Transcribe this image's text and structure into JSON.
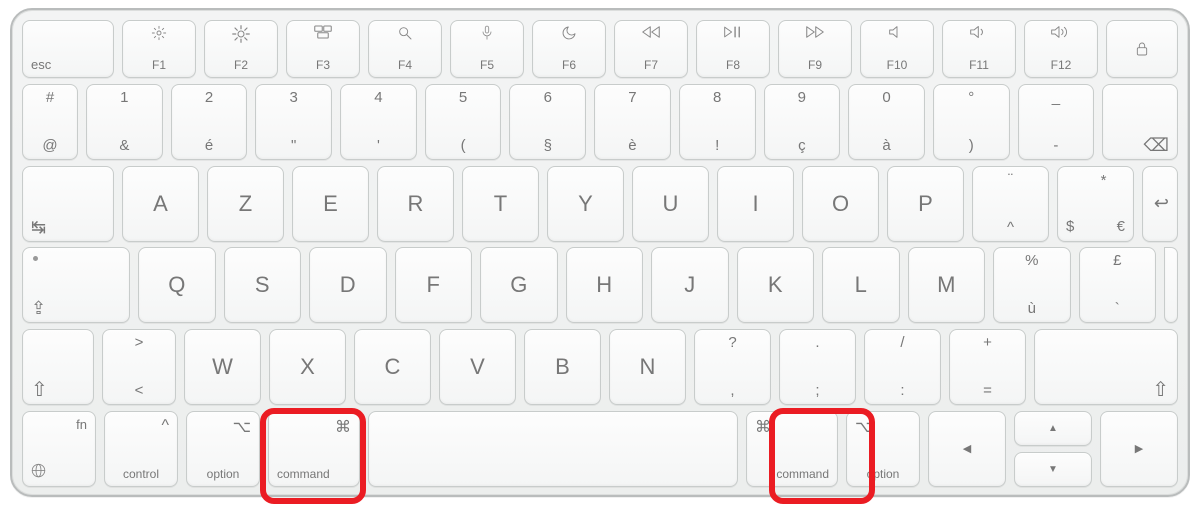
{
  "annotations": {
    "highlighted_keys": [
      "command-left",
      "command-right"
    ],
    "highlight_color": "#EB1C23"
  },
  "layout": "AZERTY-French",
  "fn_row": {
    "esc": "esc",
    "keys": [
      {
        "id": "f1",
        "label": "F1",
        "icon": "brightness-down"
      },
      {
        "id": "f2",
        "label": "F2",
        "icon": "brightness-up"
      },
      {
        "id": "f3",
        "label": "F3",
        "icon": "mission-control"
      },
      {
        "id": "f4",
        "label": "F4",
        "icon": "spotlight"
      },
      {
        "id": "f5",
        "label": "F5",
        "icon": "dictation"
      },
      {
        "id": "f6",
        "label": "F6",
        "icon": "dnd"
      },
      {
        "id": "f7",
        "label": "F7",
        "icon": "rewind"
      },
      {
        "id": "f8",
        "label": "F8",
        "icon": "play-pause"
      },
      {
        "id": "f9",
        "label": "F9",
        "icon": "forward"
      },
      {
        "id": "f10",
        "label": "F10",
        "icon": "mute"
      },
      {
        "id": "f11",
        "label": "F11",
        "icon": "vol-down"
      },
      {
        "id": "f12",
        "label": "F12",
        "icon": "vol-up"
      }
    ],
    "lock": "lock"
  },
  "row1": {
    "lead": {
      "id": "at-hash",
      "top": "#",
      "bottom": "@"
    },
    "keys": [
      {
        "id": "k1",
        "top": "1",
        "bottom": "&"
      },
      {
        "id": "k2",
        "top": "2",
        "bottom": "é"
      },
      {
        "id": "k3",
        "top": "3",
        "bottom": "\""
      },
      {
        "id": "k4",
        "top": "4",
        "bottom": "'"
      },
      {
        "id": "k5",
        "top": "5",
        "bottom": "("
      },
      {
        "id": "k6",
        "top": "6",
        "bottom": "§"
      },
      {
        "id": "k7",
        "top": "7",
        "bottom": "è"
      },
      {
        "id": "k8",
        "top": "8",
        "bottom": "!"
      },
      {
        "id": "k9",
        "top": "9",
        "bottom": "ç"
      },
      {
        "id": "k0",
        "top": "0",
        "bottom": "à"
      },
      {
        "id": "k-degree",
        "top": "°",
        "bottom": ")"
      },
      {
        "id": "k-minus",
        "top": "_",
        "bottom": "-"
      }
    ],
    "backspace": "⌫"
  },
  "row2": {
    "tab": "↹",
    "keys": [
      {
        "id": "A",
        "ctr": "A"
      },
      {
        "id": "Z",
        "ctr": "Z"
      },
      {
        "id": "E",
        "ctr": "E"
      },
      {
        "id": "R",
        "ctr": "R"
      },
      {
        "id": "T",
        "ctr": "T"
      },
      {
        "id": "Y",
        "ctr": "Y"
      },
      {
        "id": "U",
        "ctr": "U"
      },
      {
        "id": "I",
        "ctr": "I"
      },
      {
        "id": "O",
        "ctr": "O"
      },
      {
        "id": "P",
        "ctr": "P"
      },
      {
        "id": "caret",
        "top": "¨",
        "bottom": "^"
      },
      {
        "id": "dollar",
        "top": "*",
        "bl": "$",
        "br": "€"
      }
    ],
    "enter": "↩"
  },
  "row3": {
    "caps": "⇪",
    "keys": [
      {
        "id": "Q",
        "ctr": "Q"
      },
      {
        "id": "S",
        "ctr": "S"
      },
      {
        "id": "D",
        "ctr": "D"
      },
      {
        "id": "F",
        "ctr": "F"
      },
      {
        "id": "G",
        "ctr": "G"
      },
      {
        "id": "H",
        "ctr": "H"
      },
      {
        "id": "J",
        "ctr": "J"
      },
      {
        "id": "K",
        "ctr": "K"
      },
      {
        "id": "L",
        "ctr": "L"
      },
      {
        "id": "M",
        "ctr": "M"
      },
      {
        "id": "percent",
        "top": "%",
        "bottom": "ù"
      },
      {
        "id": "pound",
        "top": "£",
        "bottom": "`"
      }
    ]
  },
  "row4": {
    "lshift": "⇧",
    "angle": {
      "top": ">",
      "bottom": "<"
    },
    "keys": [
      {
        "id": "W",
        "ctr": "W"
      },
      {
        "id": "X",
        "ctr": "X"
      },
      {
        "id": "C",
        "ctr": "C"
      },
      {
        "id": "V",
        "ctr": "V"
      },
      {
        "id": "B",
        "ctr": "B"
      },
      {
        "id": "N",
        "ctr": "N"
      },
      {
        "id": "question",
        "top": "?",
        "bottom": ","
      },
      {
        "id": "period",
        "top": ".",
        "bottom": ";"
      },
      {
        "id": "slash",
        "top": "/",
        "bottom": ":"
      },
      {
        "id": "plus",
        "top": "+",
        "bottom": "="
      }
    ],
    "rshift": "⇧"
  },
  "row5": {
    "fn": {
      "label": "fn",
      "globe": "🌐"
    },
    "control": {
      "label": "control",
      "sym": "^"
    },
    "loption": {
      "label": "option",
      "sym": "⌥"
    },
    "lcommand": {
      "label": "command",
      "sym": "⌘"
    },
    "space": " ",
    "rcommand": {
      "label": "command",
      "sym": "⌘"
    },
    "roption": {
      "label": "option",
      "sym": "⌥"
    },
    "arrows": {
      "left": "◀",
      "right": "▶",
      "up": "▲",
      "down": "▼"
    }
  }
}
